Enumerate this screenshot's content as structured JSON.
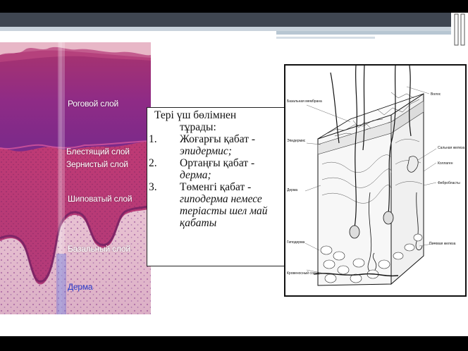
{
  "histology": {
    "labels": {
      "horny": "Роговой слой",
      "lucid": "Блестящий слой",
      "granular": "Зернистый слой",
      "spinous": "Шиповатый слой",
      "basal": "Базальный слой",
      "dermis": "Дерма"
    }
  },
  "text_box": {
    "title_line1": "Тері үш бөлімнен",
    "title_line2": "тұрады:",
    "items": [
      {
        "number": "1.",
        "text": "Жоғарғы қабат -",
        "definition": "эпидермис;"
      },
      {
        "number": "2.",
        "text": "Ортаңғы қабат -",
        "definition": "дерма;"
      },
      {
        "number": "3.",
        "text": "Төменгі қабат -",
        "definition": "гиподерма немесе теріасты шел май қабаты"
      }
    ]
  },
  "diagram": {
    "labels": {
      "hair": "Волос",
      "basement_membrane": "Базальная мембрана",
      "epidermis": "Эпидермис",
      "sebaceous_gland": "Сальная железа",
      "collagen": "Коллаген",
      "fibroblasts": "Фибробласты",
      "dermis": "Дерма",
      "hypodermis": "Гиподерма",
      "sweat_gland": "Потовая железа",
      "blood_vessel": "Кровеносный сосуд"
    }
  },
  "colors": {
    "header_band": "#3f4651",
    "stratum_corneum": "#8c2a86",
    "epidermis": "#b0306f",
    "dermis": "#e7c3d2"
  }
}
